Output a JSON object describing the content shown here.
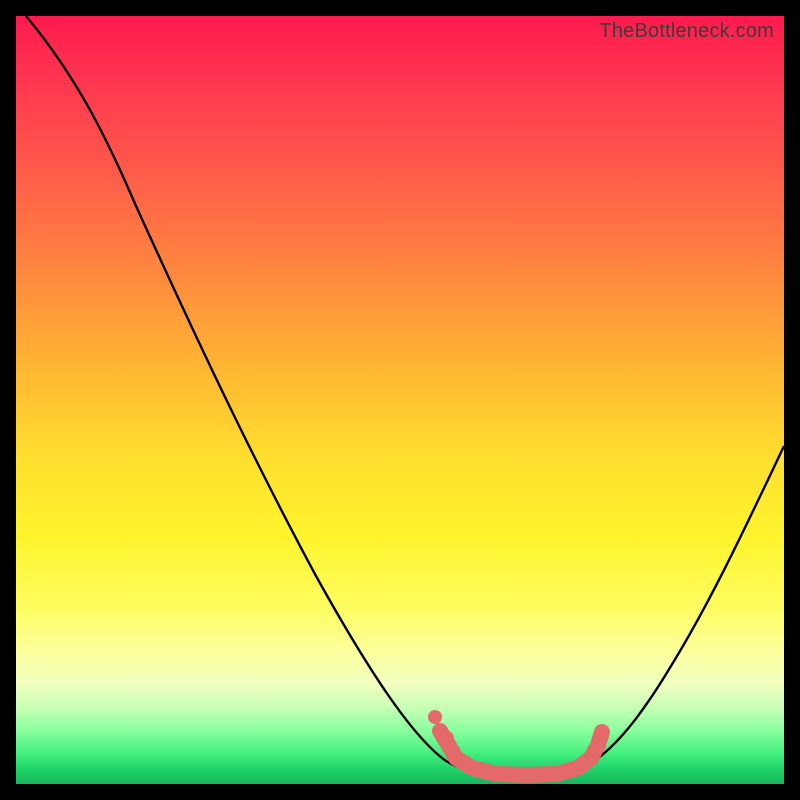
{
  "watermark": "TheBottleneck.com",
  "chart_data": {
    "type": "line",
    "title": "",
    "xlabel": "",
    "ylabel": "",
    "xlim": [
      0,
      100
    ],
    "ylim": [
      0,
      100
    ],
    "series": [
      {
        "name": "bottleneck-curve",
        "x": [
          0,
          5,
          10,
          15,
          20,
          25,
          30,
          35,
          40,
          45,
          50,
          53,
          55,
          58,
          60,
          62,
          65,
          68,
          70,
          73,
          76,
          80,
          85,
          90,
          95,
          100
        ],
        "y": [
          100,
          96,
          90,
          83,
          76,
          68,
          59,
          50,
          41,
          32,
          22,
          15,
          11,
          7,
          4,
          3,
          2,
          1.5,
          1.5,
          2,
          4,
          9,
          18,
          29,
          41,
          54
        ]
      }
    ],
    "highlight": {
      "name": "bottom-band",
      "color": "#e46a6a",
      "points_x": [
        55,
        58,
        60,
        62,
        65,
        68,
        70,
        73,
        76
      ],
      "points_y": [
        11,
        7,
        4,
        3,
        2,
        1.5,
        1.5,
        2,
        4
      ]
    },
    "background_gradient": {
      "top": "#ff1a4d",
      "mid": "#ffe02e",
      "bottom": "#18b85a"
    }
  }
}
